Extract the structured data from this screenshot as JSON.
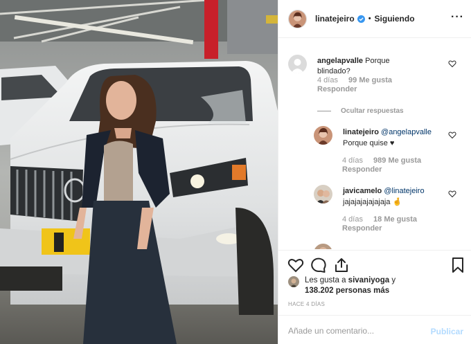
{
  "header": {
    "username": "linatejeiro",
    "separator": "•",
    "follow_status": "Siguiendo",
    "more_icon": "more-horizontal-icon"
  },
  "comments": [
    {
      "username": "angelapvalle",
      "text": "Porque blindado?",
      "time": "4 días",
      "likes": "99 Me gusta",
      "reply": "Responder"
    }
  ],
  "hide_replies": "Ocultar respuestas",
  "replies": [
    {
      "username": "linatejeiro",
      "mention": "@angelapvalle",
      "text": "Porque quise ♥",
      "time": "4 días",
      "likes": "989 Me gusta",
      "reply": "Responder"
    },
    {
      "username": "javicamelo",
      "mention": "@linatejeiro",
      "text": "jajajajajajajaja 🤞",
      "time": "4 días",
      "likes": "18 Me gusta",
      "reply": "Responder"
    }
  ],
  "likes": {
    "prefix": "Les gusta a",
    "user": "sivaniyoga",
    "conj": "y",
    "count": "138.202 personas más"
  },
  "timestamp": "HACE 4 DÍAS",
  "add_comment": {
    "placeholder": "Añade un comentario...",
    "publish": "Publicar"
  },
  "colors": {
    "text": "#262626",
    "muted": "#999999",
    "verified": "#3897f0",
    "publish_disabled": "#b3dbff"
  }
}
